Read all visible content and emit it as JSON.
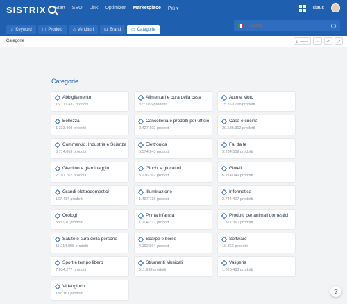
{
  "brand": {
    "logo_text": "SISTRIX"
  },
  "nav": [
    {
      "label": "Start",
      "active": false
    },
    {
      "label": "SEO",
      "active": false
    },
    {
      "label": "Link",
      "active": false
    },
    {
      "label": "Optimizer",
      "active": false
    },
    {
      "label": "Marketplace",
      "active": true
    },
    {
      "label": "Più ▾",
      "active": false
    }
  ],
  "user": {
    "name": "claus"
  },
  "tabs": [
    {
      "label": "Keyword",
      "icon": "key-icon",
      "active": false
    },
    {
      "label": "Prodotti",
      "icon": "box-icon",
      "active": false
    },
    {
      "label": "Venditori",
      "icon": "store-icon",
      "active": false
    },
    {
      "label": "Brand",
      "icon": "cart-icon",
      "active": false
    },
    {
      "label": "Categorie",
      "icon": "folder-icon",
      "active": true
    }
  ],
  "search": {
    "placeholder": "Cerca",
    "country_flag": "IT"
  },
  "breadcrumb": "Categorie",
  "section": {
    "title": "Categorie"
  },
  "categories": [
    {
      "name": "Abbigliamento",
      "count": "15.777.437 prodotti"
    },
    {
      "name": "Alimentari e cura della casa",
      "count": "327.955 prodotti"
    },
    {
      "name": "Auto e Moto",
      "count": "15.369.798 prodotti"
    },
    {
      "name": "Bellezza",
      "count": "1.333.408 prodotti"
    },
    {
      "name": "Cancelleria e prodotti per ufficio",
      "count": "2.427.102 prodotti"
    },
    {
      "name": "Casa e cucina",
      "count": "29.533.312 prodotti"
    },
    {
      "name": "Commercio, Industria e Scienza",
      "count": "3.714.069 prodotti"
    },
    {
      "name": "Elettronica",
      "count": "5.374.243 prodotti"
    },
    {
      "name": "Fai da te",
      "count": "9.234.509 prodotti"
    },
    {
      "name": "Giardino e giardinaggio",
      "count": "2.797.707 prodotti"
    },
    {
      "name": "Giochi e giocattoli",
      "count": "3.276.362 prodotti"
    },
    {
      "name": "Gioielli",
      "count": "5.214.049 prodotti"
    },
    {
      "name": "Grandi elettrodomestici",
      "count": "167.414 prodotti"
    },
    {
      "name": "Illuminazione",
      "count": "1.497.716 prodotti"
    },
    {
      "name": "Informatica",
      "count": "3.744.407 prodotti"
    },
    {
      "name": "Orologi",
      "count": "333.910 prodotti"
    },
    {
      "name": "Prima infanzia",
      "count": "1.204.317 prodotti"
    },
    {
      "name": "Prodotti per animali domestici",
      "count": "1.317.360 prodotti"
    },
    {
      "name": "Salute e cura della persona",
      "count": "11.214.098 prodotti"
    },
    {
      "name": "Scarpe e borse",
      "count": "4.162.894 prodotti"
    },
    {
      "name": "Software",
      "count": "19.362 prodotti"
    },
    {
      "name": "Sport e tempo libero",
      "count": "7.634.277 prodotti"
    },
    {
      "name": "Strumenti Musicali",
      "count": "511.998 prodotti"
    },
    {
      "name": "Valigeria",
      "count": "1.326.483 prodotti"
    },
    {
      "name": "Videogiochi",
      "count": "137.161 prodotti"
    }
  ],
  "colors": {
    "brand": "#1f5fb0",
    "background": "#f2f3f5"
  }
}
